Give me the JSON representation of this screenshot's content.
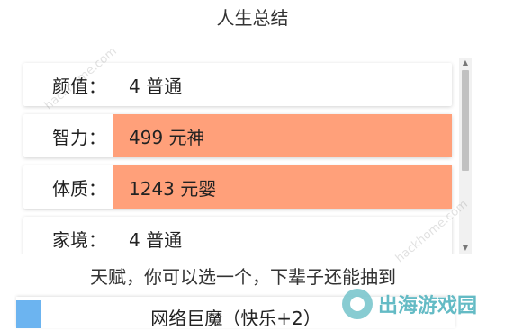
{
  "header": {
    "title": "人生总结"
  },
  "summary": {
    "rows": [
      {
        "label": "颜值：",
        "value": "4 普通",
        "highlight": false
      },
      {
        "label": "智力：",
        "value": "499 元神",
        "highlight": true
      },
      {
        "label": "体质：",
        "value": "1243 元婴",
        "highlight": true
      },
      {
        "label": "家境：",
        "value": "4 普通",
        "highlight": false
      }
    ],
    "highlight_color": "#ffa07a"
  },
  "talent": {
    "hint": "天赋，你可以选一个，下辈子还能抽到",
    "items": [
      {
        "label": "网络巨魔（快乐+2）",
        "tag_color": "#6cb4f0"
      }
    ]
  },
  "watermark": {
    "brand": "出海游戏园",
    "url": "hackhome.com"
  }
}
